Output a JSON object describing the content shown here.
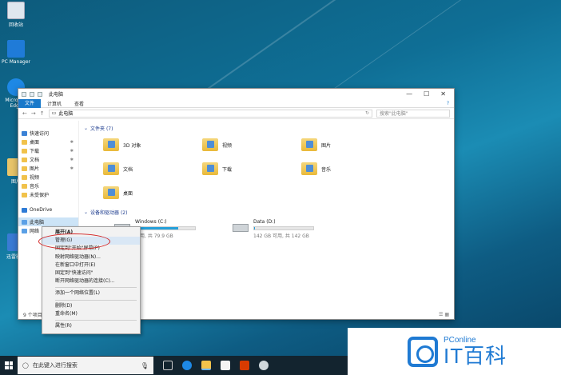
{
  "desktop": {
    "icons": [
      {
        "label": "回收站"
      },
      {
        "label": "PC Manager"
      },
      {
        "label": "Microsoft Edge"
      },
      {
        "label": "图片"
      },
      {
        "label": "迅雷影音"
      }
    ]
  },
  "explorer": {
    "title": "此电脑",
    "ribbon": {
      "file": "文件",
      "tabs": [
        "计算机",
        "查看"
      ]
    },
    "address": "此电脑",
    "search_placeholder": "搜索\"此电脑\"",
    "nav": [
      {
        "label": "快速访问",
        "pinned": false
      },
      {
        "label": "桌面",
        "pinned": true
      },
      {
        "label": "下载",
        "pinned": true
      },
      {
        "label": "文档",
        "pinned": true
      },
      {
        "label": "图片",
        "pinned": true
      },
      {
        "label": "视频",
        "pinned": false
      },
      {
        "label": "音乐",
        "pinned": false
      },
      {
        "label": "未受保护",
        "pinned": false
      },
      {
        "label": "OneDrive",
        "pinned": false
      },
      {
        "label": "此电脑",
        "pinned": false
      },
      {
        "label": "网络",
        "pinned": false
      }
    ],
    "folders_header": "文件夹 (7)",
    "folders": [
      "3D 对象",
      "视频",
      "图片",
      "文档",
      "下载",
      "音乐",
      "桌面"
    ],
    "devices_header": "设备和驱动器 (2)",
    "drives": [
      {
        "name": "Windows (C:)",
        "free": "可用, 共 79.9 GB",
        "used_fraction": 0.72
      },
      {
        "name": "Data (D:)",
        "free": "142 GB 可用, 共 142 GB",
        "used_fraction": 0.02
      }
    ],
    "status": "9 个项目"
  },
  "context_menu": {
    "items": [
      {
        "label": "展开(A)",
        "bold": true
      },
      {
        "label": "管理(G)",
        "highlight": true
      },
      {
        "label": "固定到\"开始\"屏幕(P)"
      },
      {
        "label": "映射网络驱动器(N)..."
      },
      {
        "label": "在新窗口中打开(E)"
      },
      {
        "label": "固定到\"快速访问\""
      },
      {
        "label": "断开网络驱动器的连接(C)..."
      },
      {
        "label": "添加一个网络位置(L)",
        "sep_before": true
      },
      {
        "label": "删除(D)",
        "sep_before": true
      },
      {
        "label": "重命名(M)"
      },
      {
        "label": "属性(R)",
        "sep_before": true
      }
    ]
  },
  "taskbar": {
    "search_placeholder": "在此键入进行搜索"
  },
  "watermark": {
    "small": "PConline",
    "big": "IT百科"
  },
  "colors": {
    "accent": "#1979ca",
    "highlight_oval": "#d32222",
    "taskbar": "#13242f"
  }
}
